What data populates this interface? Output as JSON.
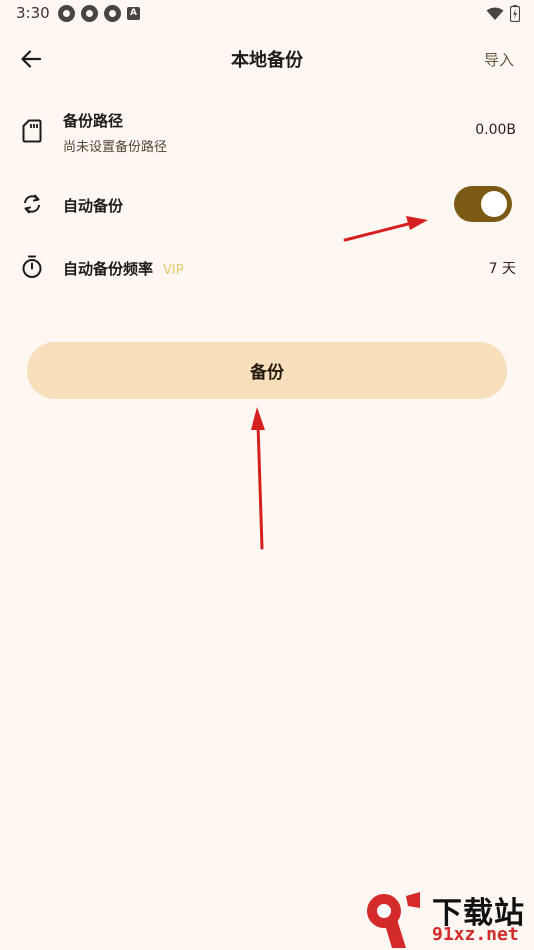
{
  "status_bar": {
    "time": "3:30",
    "notification_icons": [
      "pinwheel-icon",
      "pinwheel-icon",
      "pinwheel-icon",
      "a-icon"
    ],
    "a_icon_letter": "A"
  },
  "app_bar": {
    "title": "本地备份",
    "import_label": "导入"
  },
  "settings": {
    "backup_path": {
      "title": "备份路径",
      "subtitle": "尚未设置备份路径",
      "value": "0.00B"
    },
    "auto_backup": {
      "title": "自动备份",
      "enabled": true
    },
    "auto_backup_frequency": {
      "title": "自动备份频率",
      "badge": "VIP",
      "value": "7 天"
    }
  },
  "backup_button": {
    "label": "备份"
  },
  "watermark": {
    "main_text": "下载站",
    "sub_text": "91xz.net"
  },
  "colors": {
    "background": "#fff8f2",
    "toggle_on": "#7a5a14",
    "backup_button_bg": "#f6dfba",
    "vip": "#e8c96a",
    "annotation_arrow": "#d62020"
  }
}
